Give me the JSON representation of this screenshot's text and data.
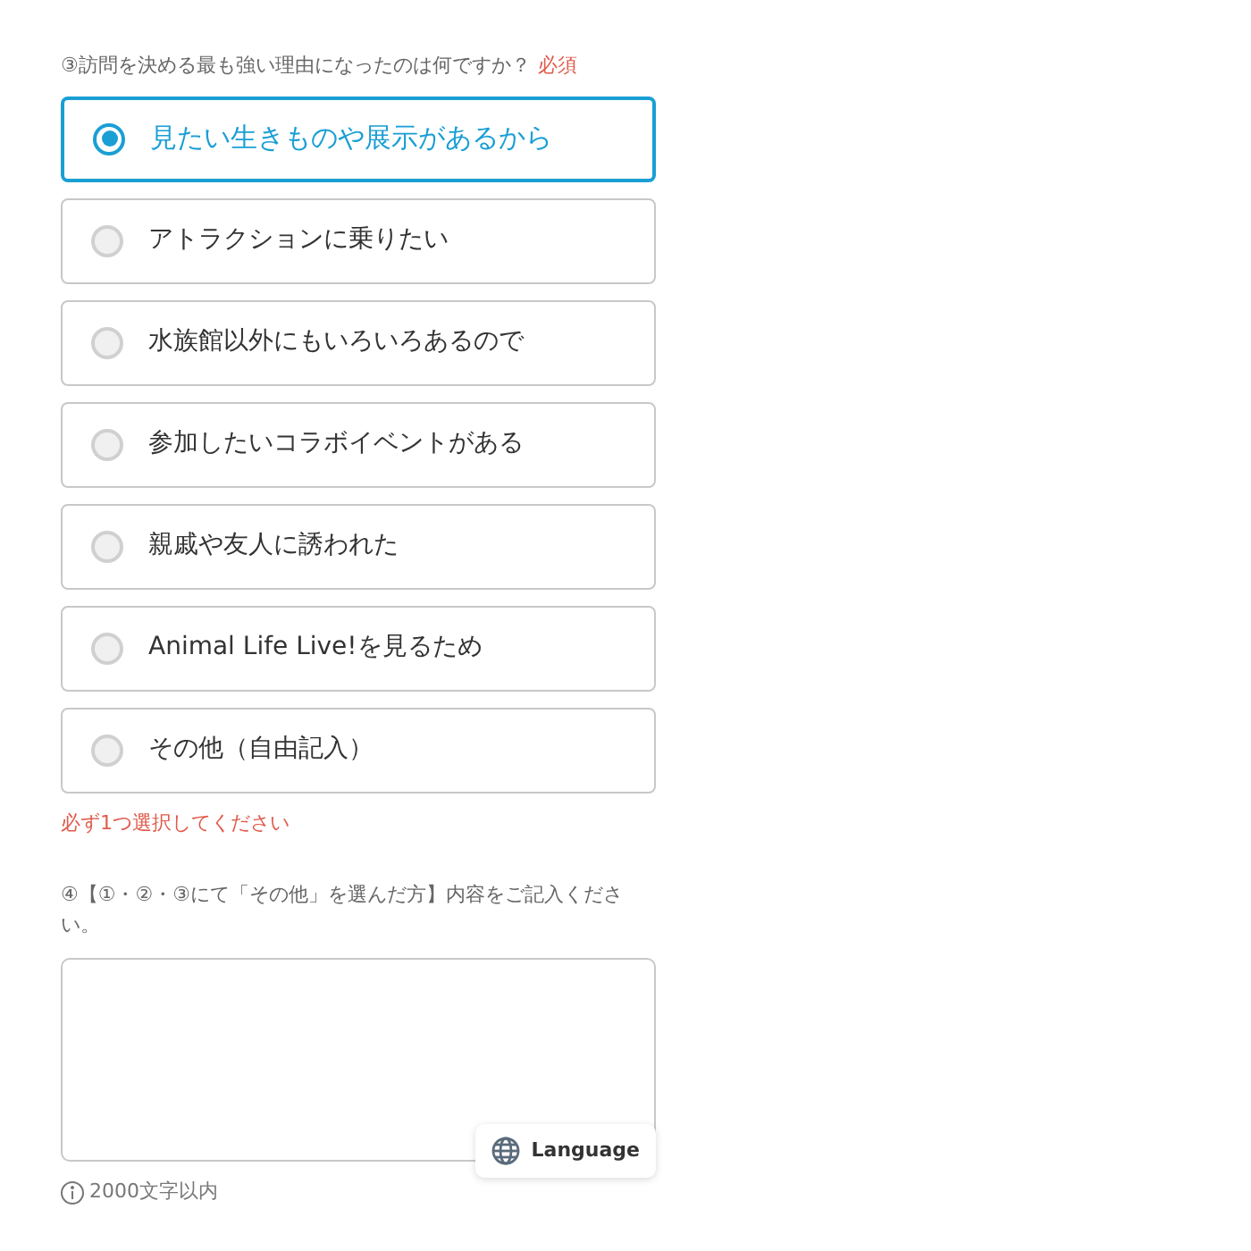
{
  "question_3": {
    "label": "③訪問を決める最も強い理由になったのは何ですか？",
    "required_badge": "必須",
    "options": [
      {
        "label": "見たい生きものや展示があるから",
        "selected": true
      },
      {
        "label": "アトラクションに乗りたい",
        "selected": false
      },
      {
        "label": "水族館以外にもいろいろあるので",
        "selected": false
      },
      {
        "label": "参加したいコラボイベントがある",
        "selected": false
      },
      {
        "label": "親戚や友人に誘われた",
        "selected": false
      },
      {
        "label": "Animal Life Live!を見るため",
        "selected": false
      },
      {
        "label": "その他（自由記入）",
        "selected": false
      }
    ],
    "error": "必ず1つ選択してください"
  },
  "question_4": {
    "label": "④【①・②・③にて「その他」を選んだ方】内容をご記入ください。",
    "note": "2000文字以内"
  },
  "language_button": {
    "label": "Language"
  }
}
